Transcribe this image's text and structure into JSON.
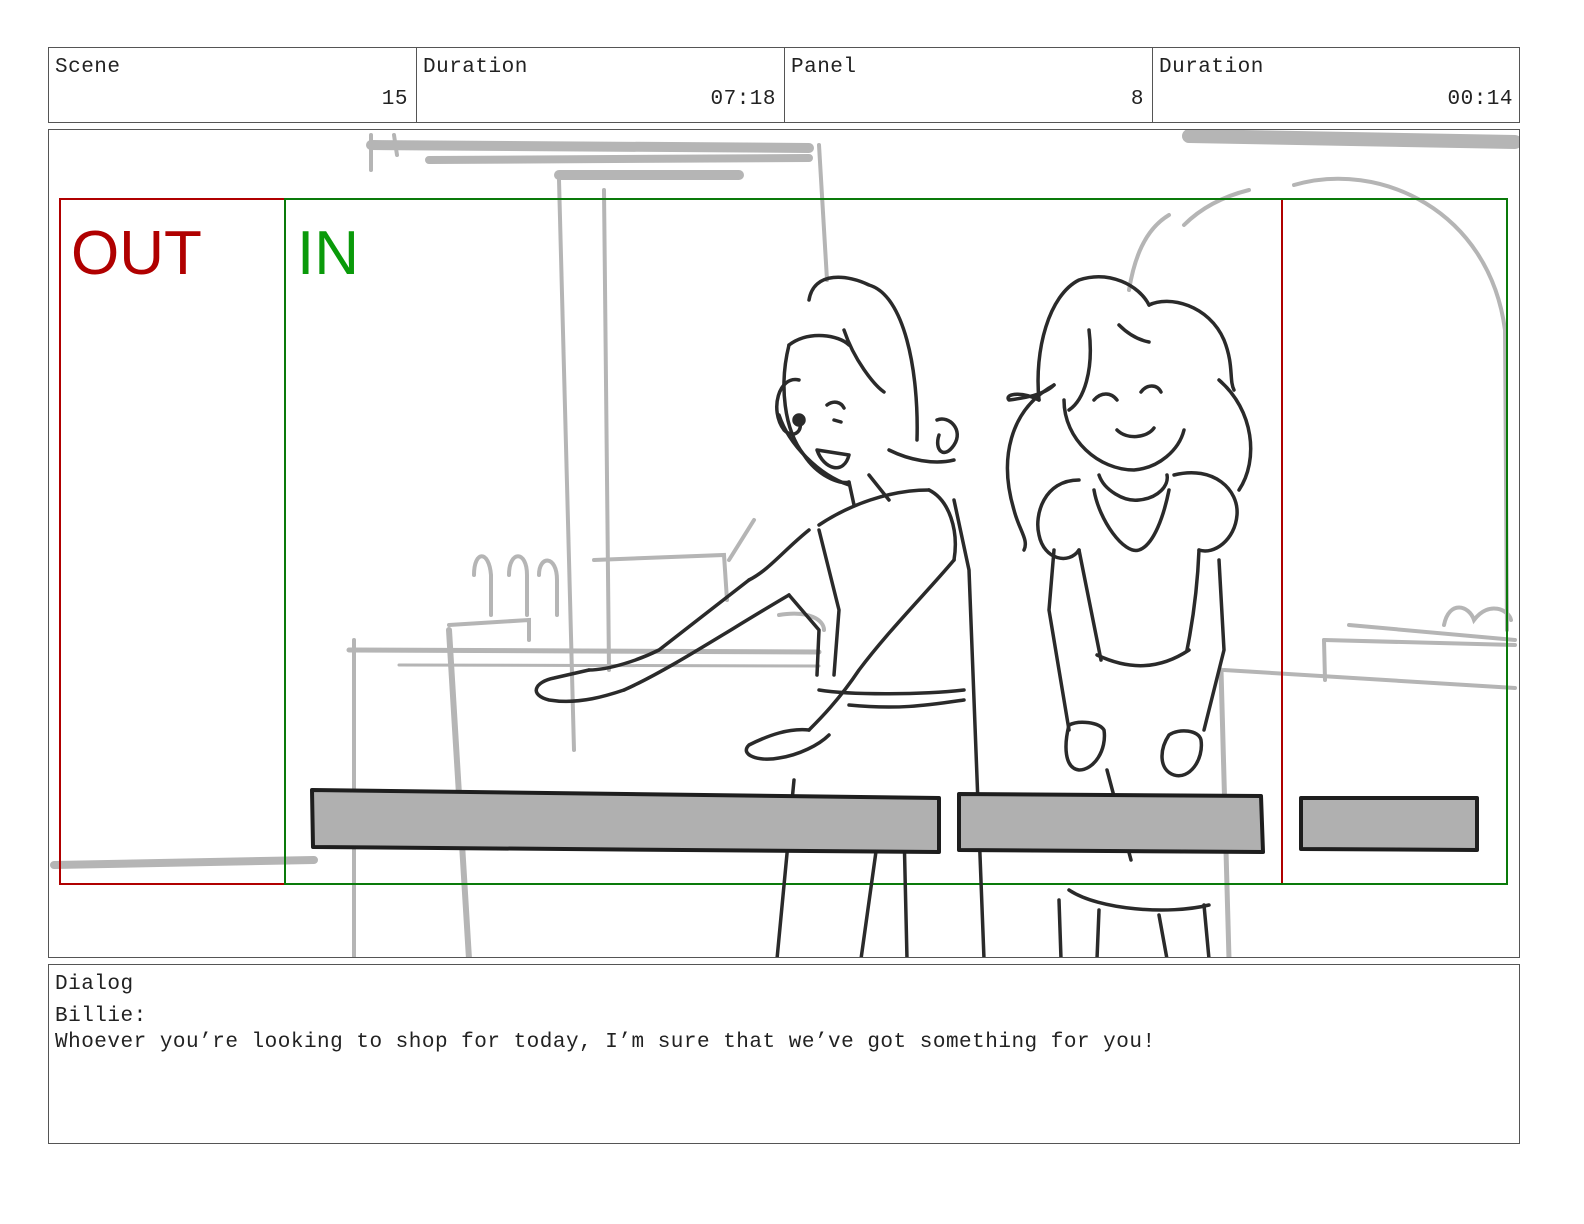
{
  "header": {
    "cells": [
      {
        "label": "Scene",
        "value": "15"
      },
      {
        "label": "Duration",
        "value": "07:18"
      },
      {
        "label": "Panel",
        "value": "8"
      },
      {
        "label": "Duration",
        "value": "00:14"
      }
    ]
  },
  "panel": {
    "out_label": "OUT",
    "in_label": "IN",
    "colors": {
      "out": "#b00000",
      "in": "#0a9a0a",
      "sketch": "#2a2a2a",
      "background_sketch": "#b5b5b5",
      "bar_fill": "#b0b0b0"
    }
  },
  "dialog": {
    "label": "Dialog",
    "speaker": "Billie:",
    "line": "Whoever you’re looking to shop for today, I’m sure that we’ve got something for you!"
  }
}
